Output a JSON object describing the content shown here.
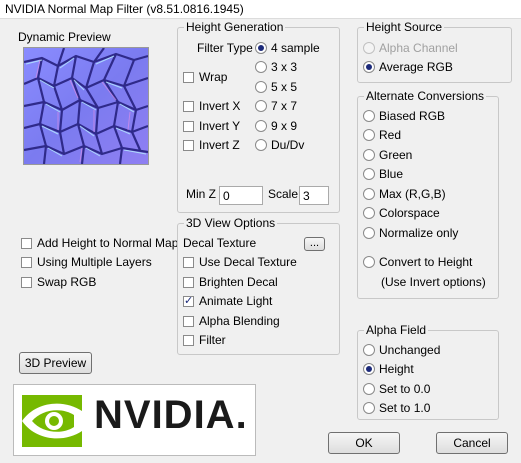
{
  "window": {
    "title": "NVIDIA Normal Map Filter (v8.51.0816.1945)"
  },
  "preview": {
    "title": "Dynamic Preview",
    "colors": {
      "base": "#7f7ff5",
      "crack": "#2f2a8a",
      "highlight": "#b7f0ff",
      "pink": "#d98ce5"
    }
  },
  "left_options": [
    {
      "label": "Add Height to Normal Map",
      "checked": false
    },
    {
      "label": "Using Multiple Layers",
      "checked": false
    },
    {
      "label": "Swap RGB",
      "checked": false
    }
  ],
  "preview3d_button": "3D Preview",
  "logo": {
    "text": "NVIDIA.",
    "icon": "nvidia-eye-icon",
    "accent": "#76b900"
  },
  "height_generation": {
    "title": "Height Generation",
    "filter_type_label": "Filter Type",
    "filters": [
      "4 sample",
      "3 x 3",
      "5 x 5",
      "7 x 7",
      "9 x 9",
      "Du/Dv"
    ],
    "selected_filter": "4 sample",
    "checkboxes": [
      "Wrap",
      "Invert X",
      "Invert Y",
      "Invert Z"
    ],
    "minz_label": "Min Z",
    "minz_value": "0",
    "scale_label": "Scale",
    "scale_value": "3"
  },
  "view3d": {
    "title": "3D View Options",
    "decal_texture_label": "Decal Texture",
    "browse_label": "...",
    "options": [
      {
        "label": "Use Decal Texture",
        "checked": false
      },
      {
        "label": "Brighten Decal",
        "checked": false
      },
      {
        "label": "Animate Light",
        "checked": true
      },
      {
        "label": "Alpha Blending",
        "checked": false
      },
      {
        "label": "Filter",
        "checked": false
      }
    ]
  },
  "height_source": {
    "title": "Height Source",
    "options": [
      {
        "label": "Alpha Channel",
        "checked": false,
        "disabled": true
      },
      {
        "label": "Average RGB",
        "checked": true,
        "disabled": false
      }
    ]
  },
  "alternate_conversions": {
    "title": "Alternate Conversions",
    "options": [
      "Biased RGB",
      "Red",
      "Green",
      "Blue",
      "Max (R,G,B)",
      "Colorspace",
      "Normalize only"
    ],
    "convert_label": "Convert to Height",
    "convert_note": "(Use Invert options)"
  },
  "alpha_field": {
    "title": "Alpha Field",
    "options": [
      "Unchanged",
      "Height",
      "Set to 0.0",
      "Set to 1.0"
    ],
    "selected": "Height"
  },
  "buttons": {
    "ok": "OK",
    "cancel": "Cancel"
  }
}
